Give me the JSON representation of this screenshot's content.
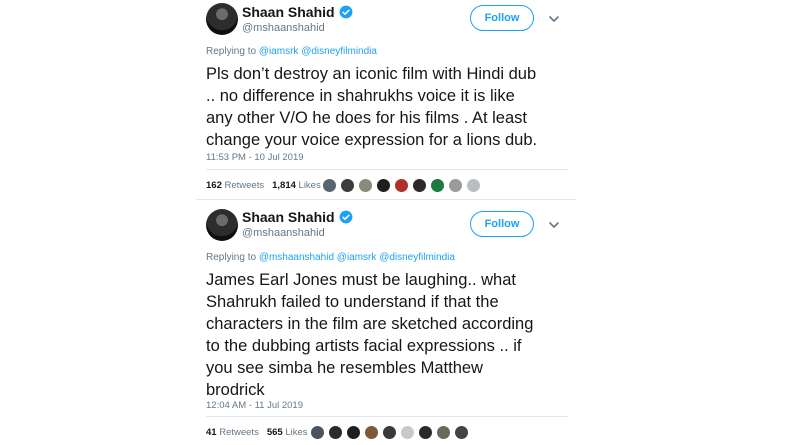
{
  "colors": {
    "accent": "#1da1f2",
    "text_primary": "#14171a",
    "text_secondary": "#657786",
    "divider": "#e1e8ed"
  },
  "tweets": [
    {
      "author_name": "Shaan Shahid",
      "author_handle": "@mshaanshahid",
      "verified_icon": "verified-badge-icon",
      "follow_label": "Follow",
      "more_icon": "chevron-down-icon",
      "replying_prefix": "Replying to",
      "replying_mentions": [
        "@iamsrk",
        "@disneyfilmindia"
      ],
      "body_lines": [
        "Pls don’t destroy an iconic film with Hindi dub",
        ".. no difference in shahrukhs voice it is like",
        "any other V/O he does for his films . At least",
        "change your voice expression for a lions dub."
      ],
      "timestamp": "11:53 PM - 10 Jul 2019",
      "retweets_count": "162",
      "retweets_label": "Retweets",
      "likes_count": "1,814",
      "likes_label": "Likes",
      "likers": [
        {
          "name": "liker-avatar",
          "color": "#5a6470"
        },
        {
          "name": "liker-avatar",
          "color": "#3c3c3c"
        },
        {
          "name": "liker-avatar",
          "color": "#8a8a7a"
        },
        {
          "name": "liker-avatar",
          "color": "#1e1e1e"
        },
        {
          "name": "liker-avatar",
          "color": "#b0302a"
        },
        {
          "name": "liker-avatar",
          "color": "#2a2a2a"
        },
        {
          "name": "liker-avatar",
          "color": "#1e7a3c"
        },
        {
          "name": "liker-avatar",
          "color": "#9a9a9a"
        },
        {
          "name": "liker-avatar",
          "color": "#b8bec4"
        }
      ]
    },
    {
      "author_name": "Shaan Shahid",
      "author_handle": "@mshaanshahid",
      "verified_icon": "verified-badge-icon",
      "follow_label": "Follow",
      "more_icon": "chevron-down-icon",
      "replying_prefix": "Replying to",
      "replying_mentions": [
        "@mshaanshahid",
        "@iamsrk",
        "@disneyfilmindia"
      ],
      "body_lines": [
        "James Earl Jones must be laughing.. what",
        "Shahrukh failed to understand if that the",
        "characters in the film are sketched according",
        "to the dubbing artists facial expressions .. if",
        "you see simba he resembles Matthew",
        "brodrick"
      ],
      "timestamp": "12:04 AM - 11 Jul 2019",
      "retweets_count": "41",
      "retweets_label": "Retweets",
      "likes_count": "565",
      "likes_label": "Likes",
      "likers": [
        {
          "name": "liker-avatar",
          "color": "#4a5560"
        },
        {
          "name": "liker-avatar",
          "color": "#2b2b2b"
        },
        {
          "name": "liker-avatar",
          "color": "#1f1f1f"
        },
        {
          "name": "liker-avatar",
          "color": "#7a5a3a"
        },
        {
          "name": "liker-avatar",
          "color": "#3a3a3a"
        },
        {
          "name": "liker-avatar",
          "color": "#c8c8c8"
        },
        {
          "name": "liker-avatar",
          "color": "#2a2a2a"
        },
        {
          "name": "liker-avatar",
          "color": "#6a6a5a"
        },
        {
          "name": "liker-avatar",
          "color": "#444444"
        }
      ]
    }
  ]
}
